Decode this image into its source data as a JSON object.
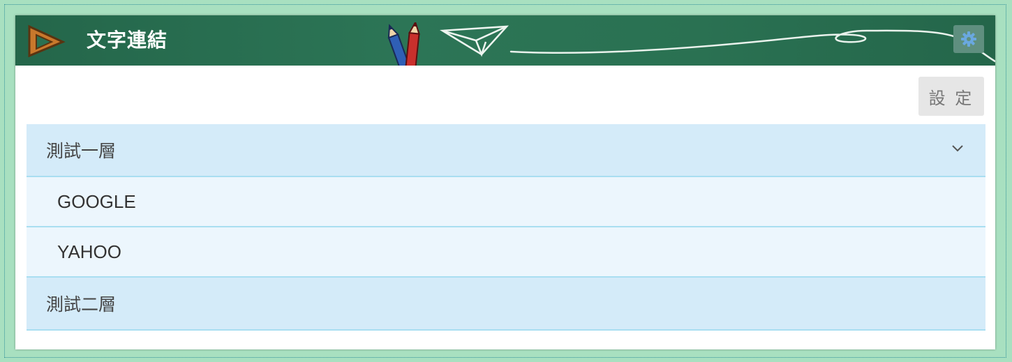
{
  "header": {
    "title": "文字連結",
    "logo_icon": "triangle-ruler-icon",
    "gear_icon": "gear-icon"
  },
  "toolbar": {
    "settings_label": "設 定"
  },
  "accordion": {
    "groups": [
      {
        "label": "測試一層",
        "expanded": true,
        "items": [
          {
            "label": "GOOGLE"
          },
          {
            "label": "YAHOO"
          }
        ]
      },
      {
        "label": "測試二層",
        "expanded": false,
        "items": []
      }
    ]
  },
  "colors": {
    "header_bg": "#2a7152",
    "group_bg": "#d4ebf9",
    "item_bg": "#ecf6fd",
    "divider": "#a9def1",
    "page_bg": "#a8e0c0"
  }
}
